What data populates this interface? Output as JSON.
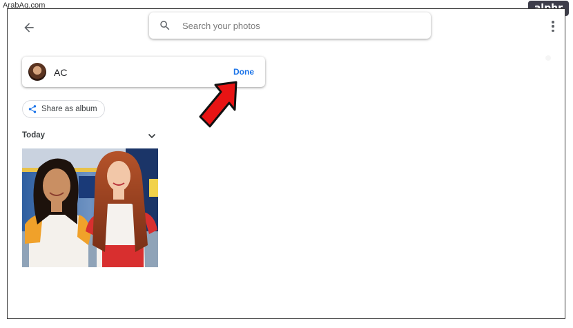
{
  "watermarks": {
    "site": "ArabAq.com",
    "brand": "alphr"
  },
  "header": {
    "back_icon": "arrow-back-icon",
    "search": {
      "placeholder": "Search your photos",
      "icon": "search-icon"
    },
    "menu_icon": "more-vert-icon"
  },
  "name_editor": {
    "value": "AC",
    "done_label": "Done"
  },
  "share": {
    "label": "Share as album",
    "icon": "share-icon"
  },
  "section": {
    "title": "Today",
    "chevron_icon": "chevron-down-icon"
  },
  "colors": {
    "accent": "#1a73e8",
    "annotation_arrow": "#e81414"
  }
}
